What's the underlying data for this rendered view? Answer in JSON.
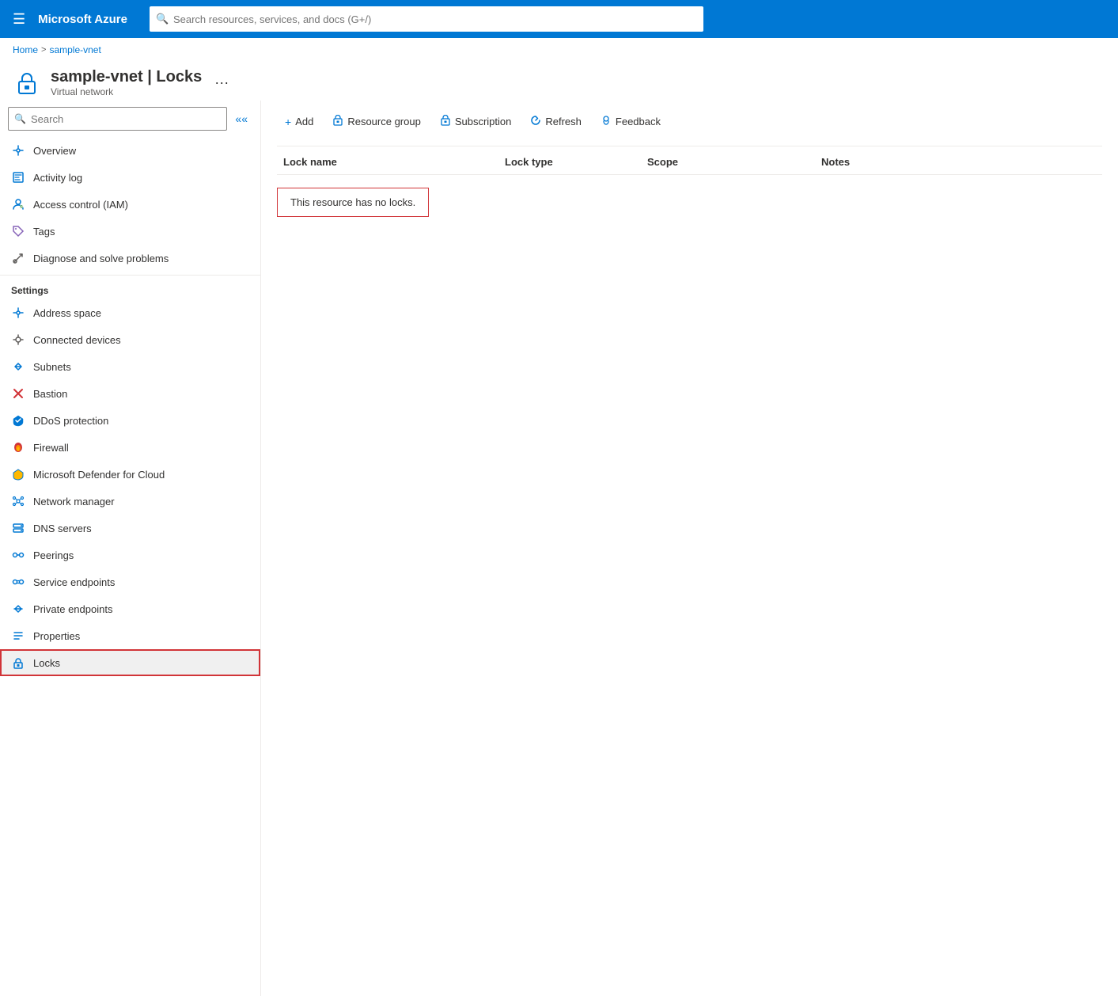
{
  "topbar": {
    "logo": "Microsoft Azure",
    "search_placeholder": "Search resources, services, and docs (G+/)"
  },
  "breadcrumb": {
    "home": "Home",
    "resource": "sample-vnet"
  },
  "page_header": {
    "title": "sample-vnet | Locks",
    "subtitle": "Virtual network",
    "more_label": "···"
  },
  "toolbar": {
    "add_label": "Add",
    "resource_group_label": "Resource group",
    "subscription_label": "Subscription",
    "refresh_label": "Refresh",
    "feedback_label": "Feedback"
  },
  "table": {
    "columns": [
      "Lock name",
      "Lock type",
      "Scope",
      "Notes"
    ],
    "empty_message": "This resource has no locks."
  },
  "sidebar": {
    "search_placeholder": "Search",
    "items_top": [
      {
        "id": "overview",
        "label": "Overview",
        "icon": "⟺"
      },
      {
        "id": "activity-log",
        "label": "Activity log",
        "icon": "📋"
      },
      {
        "id": "iam",
        "label": "Access control (IAM)",
        "icon": "👤"
      },
      {
        "id": "tags",
        "label": "Tags",
        "icon": "🏷"
      },
      {
        "id": "diagnose",
        "label": "Diagnose and solve problems",
        "icon": "🔧"
      }
    ],
    "settings_section": "Settings",
    "settings_items": [
      {
        "id": "address-space",
        "label": "Address space",
        "icon": "⟺"
      },
      {
        "id": "connected-devices",
        "label": "Connected devices",
        "icon": "🔌"
      },
      {
        "id": "subnets",
        "label": "Subnets",
        "icon": "<>"
      },
      {
        "id": "bastion",
        "label": "Bastion",
        "icon": "✕"
      },
      {
        "id": "ddos",
        "label": "DDoS protection",
        "icon": "🛡"
      },
      {
        "id": "firewall",
        "label": "Firewall",
        "icon": "🔴"
      },
      {
        "id": "defender",
        "label": "Microsoft Defender for Cloud",
        "icon": "🛡"
      },
      {
        "id": "network-manager",
        "label": "Network manager",
        "icon": "⚙"
      },
      {
        "id": "dns-servers",
        "label": "DNS servers",
        "icon": "🖥"
      },
      {
        "id": "peerings",
        "label": "Peerings",
        "icon": "🔗"
      },
      {
        "id": "service-endpoints",
        "label": "Service endpoints",
        "icon": "🔗"
      },
      {
        "id": "private-endpoints",
        "label": "Private endpoints",
        "icon": "⇌"
      },
      {
        "id": "properties",
        "label": "Properties",
        "icon": "≡"
      },
      {
        "id": "locks",
        "label": "Locks",
        "icon": "🔒"
      }
    ]
  }
}
